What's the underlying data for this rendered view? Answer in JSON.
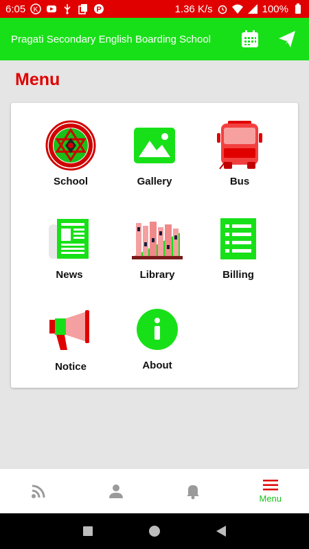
{
  "status_bar": {
    "time": "6:05",
    "network_speed": "1.36 K/s",
    "battery": "100%",
    "icons": [
      "k-icon",
      "youtube-icon",
      "usb-icon",
      "copy-icon",
      "parking-icon",
      "alarm-icon",
      "wifi-icon",
      "signal-icon",
      "battery-icon"
    ]
  },
  "app_bar": {
    "title": "Pragati Secondary English Boarding School",
    "actions": [
      "calendar-icon",
      "send-icon"
    ]
  },
  "page": {
    "heading": "Menu"
  },
  "menu_items": [
    {
      "label": "School",
      "icon": "school-logo-icon"
    },
    {
      "label": "Gallery",
      "icon": "gallery-icon"
    },
    {
      "label": "Bus",
      "icon": "bus-icon"
    },
    {
      "label": "News",
      "icon": "newspaper-icon"
    },
    {
      "label": "Library",
      "icon": "library-icon"
    },
    {
      "label": "Billing",
      "icon": "billing-icon"
    },
    {
      "label": "Notice",
      "icon": "megaphone-icon"
    },
    {
      "label": "About",
      "icon": "info-icon"
    }
  ],
  "bottom_nav": {
    "items": [
      {
        "icon": "rss-icon",
        "label": ""
      },
      {
        "icon": "person-icon",
        "label": ""
      },
      {
        "icon": "bell-icon",
        "label": ""
      },
      {
        "icon": "menu-icon",
        "label": "Menu",
        "active": true
      }
    ]
  },
  "colors": {
    "primary_green": "#18e018",
    "accent_red": "#e00000",
    "pink": "#f08a8a"
  }
}
